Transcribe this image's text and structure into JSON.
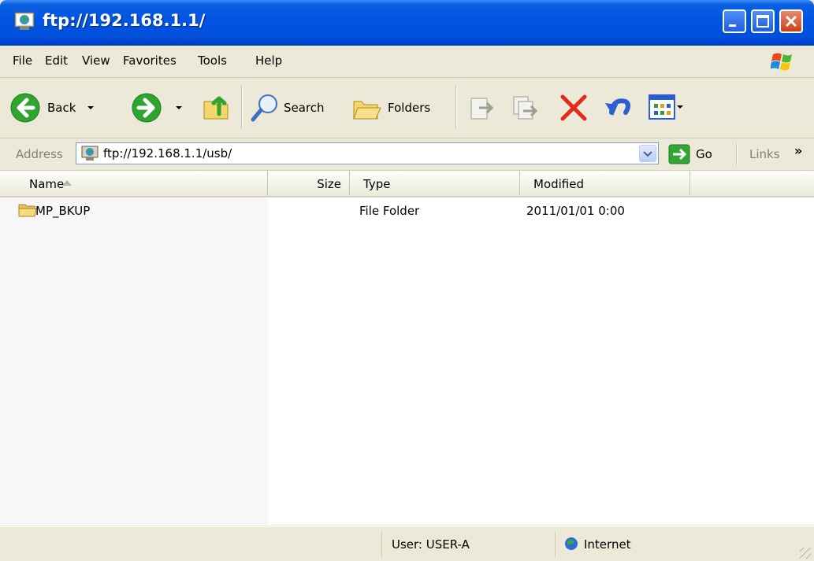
{
  "window": {
    "title": "ftp://192.168.1.1/"
  },
  "menu": [
    "File",
    "Edit",
    "View",
    "Favorites",
    "Tools",
    "Help"
  ],
  "toolbar": {
    "back_label": "Back",
    "search_label": "Search",
    "folders_label": "Folders"
  },
  "address": {
    "label": "Address",
    "value": "ftp://192.168.1.1/usb/",
    "go_label": "Go",
    "links_label": "Links",
    "links_chevron": "»"
  },
  "columns": {
    "name": "Name",
    "size": "Size",
    "type": "Type",
    "modified": "Modified"
  },
  "files": [
    {
      "name": "MP_BKUP",
      "size": "",
      "type": "File Folder",
      "modified": "2011/01/01 0:00"
    }
  ],
  "status": {
    "user": "User: USER-A",
    "zone": "Internet"
  },
  "colors": {
    "titlebar": "#0054e3",
    "close_button": "#c9421c",
    "chrome": "#ece9d8",
    "sorted_column": "#f7f7f7"
  },
  "icons": {
    "title": "ftp-globe-icon",
    "back": "back-arrow-icon",
    "forward": "forward-arrow-icon",
    "up": "up-folder-icon",
    "search": "search-icon",
    "folders": "folders-icon",
    "move_to": "move-to-icon",
    "copy_to": "copy-to-icon",
    "delete": "delete-x-icon",
    "undo": "undo-icon",
    "views": "views-icon",
    "go": "go-arrow-icon",
    "folder": "folder-icon",
    "internet": "internet-globe-icon"
  }
}
